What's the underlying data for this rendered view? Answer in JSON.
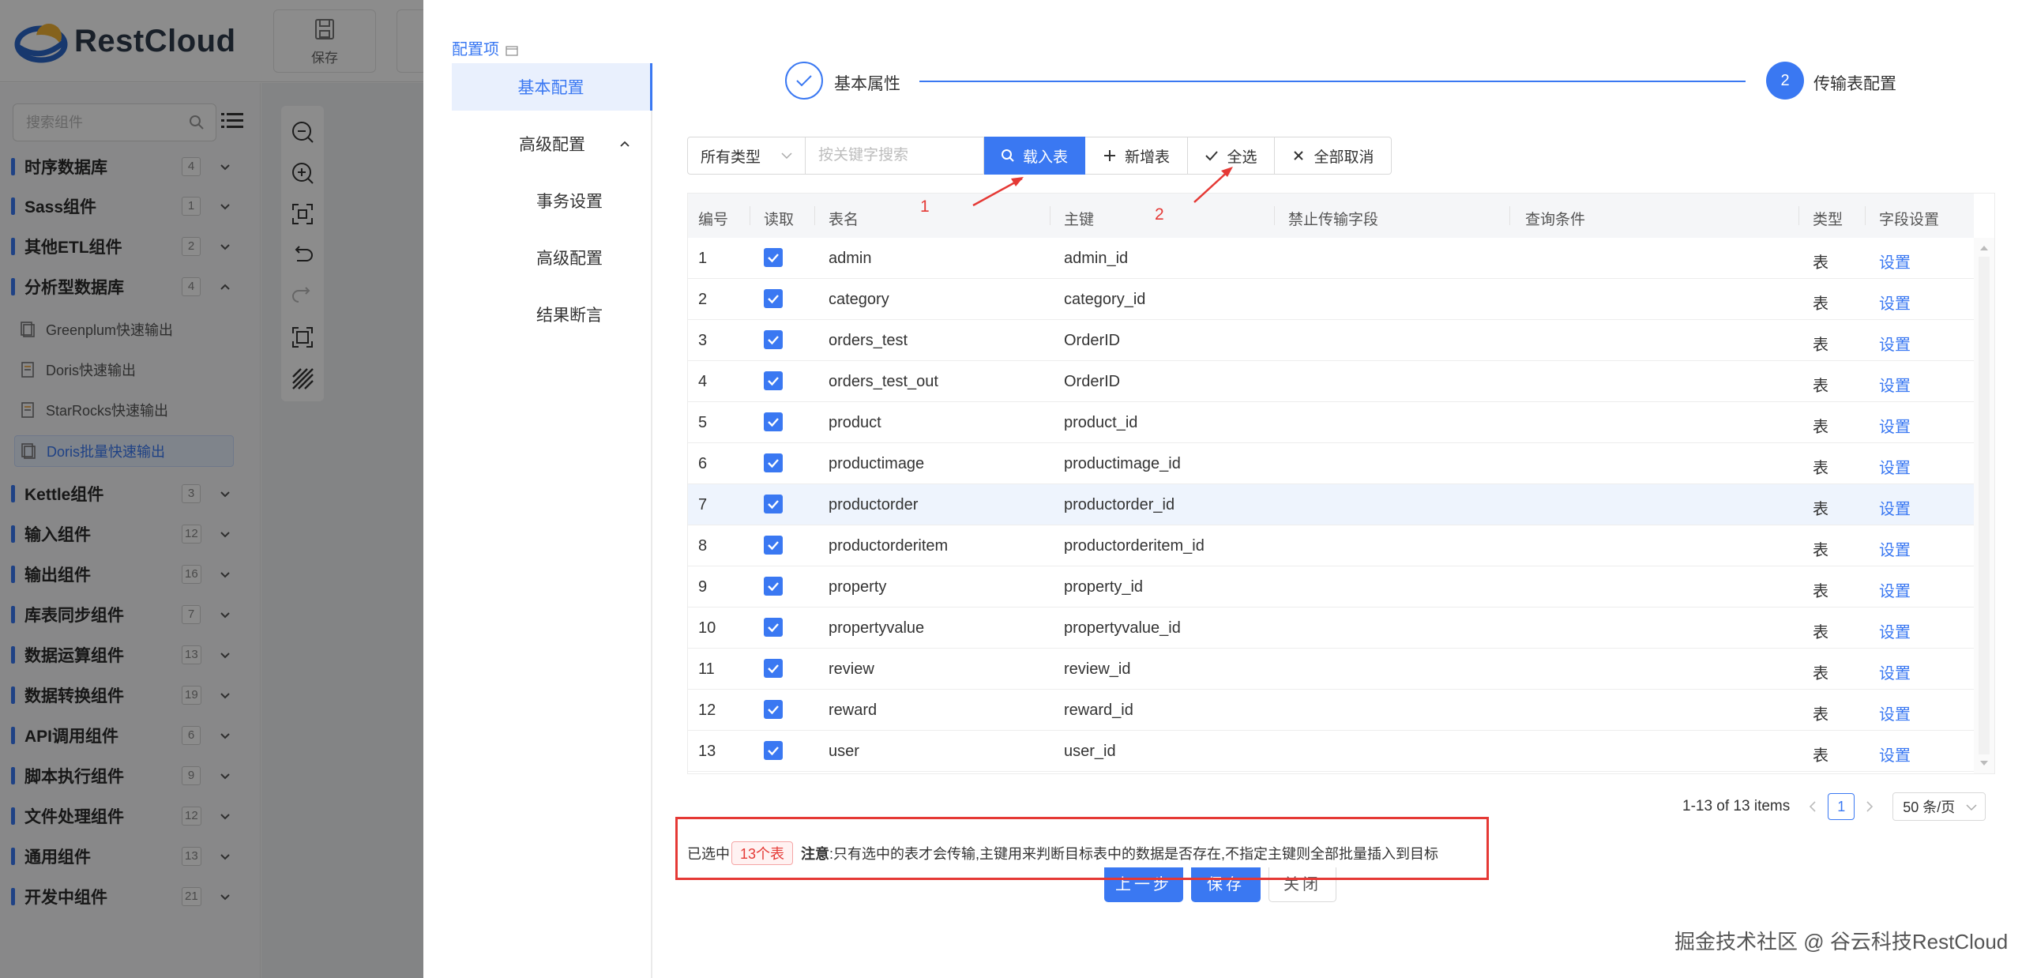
{
  "app": {
    "brand": "RestCloud",
    "header_buttons": [
      {
        "label": "保存",
        "icon": "save-icon"
      }
    ],
    "search_placeholder": "搜索组件",
    "groups": [
      {
        "name": "时序数据库",
        "count": "4",
        "expanded": false
      },
      {
        "name": "Sass组件",
        "count": "1",
        "expanded": false
      },
      {
        "name": "其他ETL组件",
        "count": "2",
        "expanded": false
      },
      {
        "name": "分析型数据库",
        "count": "4",
        "expanded": true
      },
      {
        "name": "Kettle组件",
        "count": "3",
        "expanded": false
      },
      {
        "name": "输入组件",
        "count": "12",
        "expanded": false
      },
      {
        "name": "输出组件",
        "count": "16",
        "expanded": false
      },
      {
        "name": "库表同步组件",
        "count": "7",
        "expanded": false
      },
      {
        "name": "数据运算组件",
        "count": "13",
        "expanded": false
      },
      {
        "name": "数据转换组件",
        "count": "19",
        "expanded": false
      },
      {
        "name": "API调用组件",
        "count": "6",
        "expanded": false
      },
      {
        "name": "脚本执行组件",
        "count": "9",
        "expanded": false
      },
      {
        "name": "文件处理组件",
        "count": "12",
        "expanded": false
      },
      {
        "name": "通用组件",
        "count": "13",
        "expanded": false
      },
      {
        "name": "开发中组件",
        "count": "21",
        "expanded": false
      }
    ],
    "sub_items": [
      {
        "label": "Greenplum快速输出",
        "active": false
      },
      {
        "label": "Doris快速输出",
        "active": false
      },
      {
        "label": "StarRocks快速输出",
        "active": false
      },
      {
        "label": "Doris批量快速输出",
        "active": true
      }
    ],
    "accent": "#3a78f2"
  },
  "drawer": {
    "config_title": "配置项",
    "nav": {
      "basic": "基本配置",
      "advanced": "高级配置",
      "subs": [
        "事务设置",
        "高级配置",
        "结果断言"
      ]
    },
    "steps": [
      {
        "number": "1",
        "label": "基本属性",
        "done": true
      },
      {
        "number": "2",
        "label": "传输表配置",
        "done": false
      }
    ],
    "toolbar": {
      "type_select": "所有类型",
      "keyword_placeholder": "按关键字搜索",
      "load_table": "载入表",
      "new_table": "新增表",
      "select_all": "全选",
      "cancel_all": "全部取消"
    },
    "annotations": [
      "1",
      "2"
    ],
    "table": {
      "columns": [
        "编号",
        "读取",
        "表名",
        "主键",
        "禁止传输字段",
        "查询条件",
        "类型",
        "字段设置"
      ],
      "rows": [
        {
          "no": "1",
          "name": "admin",
          "pk": "admin_id",
          "type": "表",
          "action": "设置",
          "checked": true
        },
        {
          "no": "2",
          "name": "category",
          "pk": "category_id",
          "type": "表",
          "action": "设置",
          "checked": true
        },
        {
          "no": "3",
          "name": "orders_test",
          "pk": "OrderID",
          "type": "表",
          "action": "设置",
          "checked": true
        },
        {
          "no": "4",
          "name": "orders_test_out",
          "pk": "OrderID",
          "type": "表",
          "action": "设置",
          "checked": true
        },
        {
          "no": "5",
          "name": "product",
          "pk": "product_id",
          "type": "表",
          "action": "设置",
          "checked": true
        },
        {
          "no": "6",
          "name": "productimage",
          "pk": "productimage_id",
          "type": "表",
          "action": "设置",
          "checked": true
        },
        {
          "no": "7",
          "name": "productorder",
          "pk": "productorder_id",
          "type": "表",
          "action": "设置",
          "checked": true
        },
        {
          "no": "8",
          "name": "productorderitem",
          "pk": "productorderitem_id",
          "type": "表",
          "action": "设置",
          "checked": true
        },
        {
          "no": "9",
          "name": "property",
          "pk": "property_id",
          "type": "表",
          "action": "设置",
          "checked": true
        },
        {
          "no": "10",
          "name": "propertyvalue",
          "pk": "propertyvalue_id",
          "type": "表",
          "action": "设置",
          "checked": true
        },
        {
          "no": "11",
          "name": "review",
          "pk": "review_id",
          "type": "表",
          "action": "设置",
          "checked": true
        },
        {
          "no": "12",
          "name": "reward",
          "pk": "reward_id",
          "type": "表",
          "action": "设置",
          "checked": true
        },
        {
          "no": "13",
          "name": "user",
          "pk": "user_id",
          "type": "表",
          "action": "设置",
          "checked": true
        }
      ],
      "highlighted_row": 7
    },
    "pagination": {
      "summary": "1-13 of 13 items",
      "current_page": "1",
      "page_size": "50 条/页"
    },
    "notice": {
      "prefix": "已选中",
      "selected_tag": "13个表",
      "label": "注意",
      "text": ":只有选中的表才会传输,主键用来判断目标表中的数据是否存在,不指定主键则全部批量插入到目标"
    },
    "footer": {
      "prev": "上一步",
      "save": "保存",
      "close": "关闭"
    },
    "annotation_color": "#e53935"
  },
  "watermark": "掘金技术社区 @ 谷云科技RestCloud"
}
